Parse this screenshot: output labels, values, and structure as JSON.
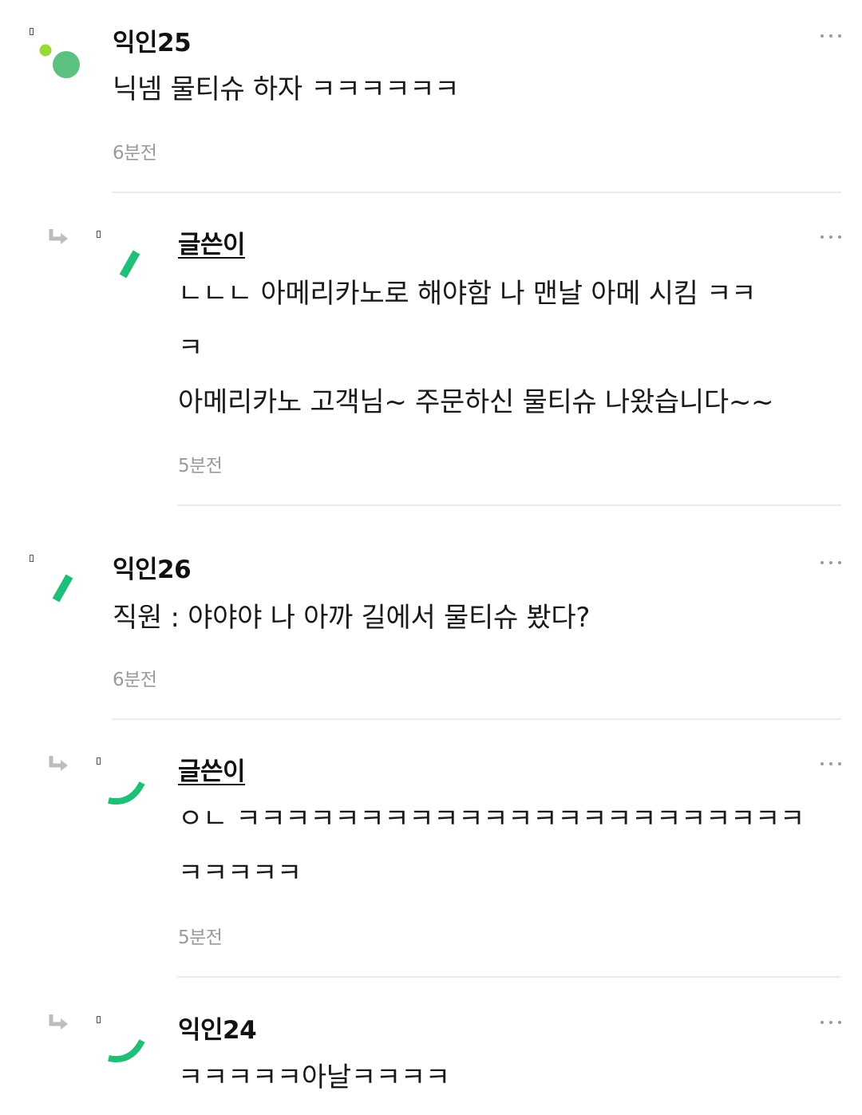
{
  "comments": [
    {
      "author": "익인25",
      "is_op": false,
      "lines": [
        "닉넴 물티슈 하자 ㅋㅋㅋㅋㅋㅋ"
      ],
      "time": "6분전",
      "avatar_icon": "dots-avatar-icon"
    },
    {
      "author": "글쓴이",
      "is_op": true,
      "lines": [
        "ㄴㄴㄴ 아메리카노로 해야함 나 맨날 아메 시킴 ㅋㅋ",
        "ㅋ",
        "아메리카노 고객님~ 주문하신 물티슈 나왔습니다~~"
      ],
      "time": "5분전",
      "avatar_icon": "slash-avatar-icon"
    },
    {
      "author": "익인26",
      "is_op": false,
      "lines": [
        "직원 : 야야야 나 아까 길에서 물티슈 봤다?"
      ],
      "time": "6분전",
      "avatar_icon": "slash-avatar-icon"
    },
    {
      "author": "글쓴이",
      "is_op": true,
      "lines": [
        "ㅇㄴ ㅋㅋㅋㅋㅋㅋㅋㅋㅋㅋㅋㅋㅋㅋㅋㅋㅋㅋㅋㅋㅋㅋㅋ",
        "ㅋㅋㅋㅋㅋ"
      ],
      "time": "5분전",
      "avatar_icon": "arc-avatar-icon"
    },
    {
      "author": "익인24",
      "is_op": false,
      "lines": [
        "ㅋㅋㅋㅋㅋ아날ㅋㅋㅋㅋ"
      ],
      "time": "",
      "avatar_icon": "arc-avatar-icon"
    }
  ],
  "colors": {
    "accent_green": "#1fbf77",
    "avatar_green": "#5cc081",
    "avatar_lime": "#9bd83a",
    "muted_text": "#9a9a9a",
    "divider": "#ececec"
  }
}
